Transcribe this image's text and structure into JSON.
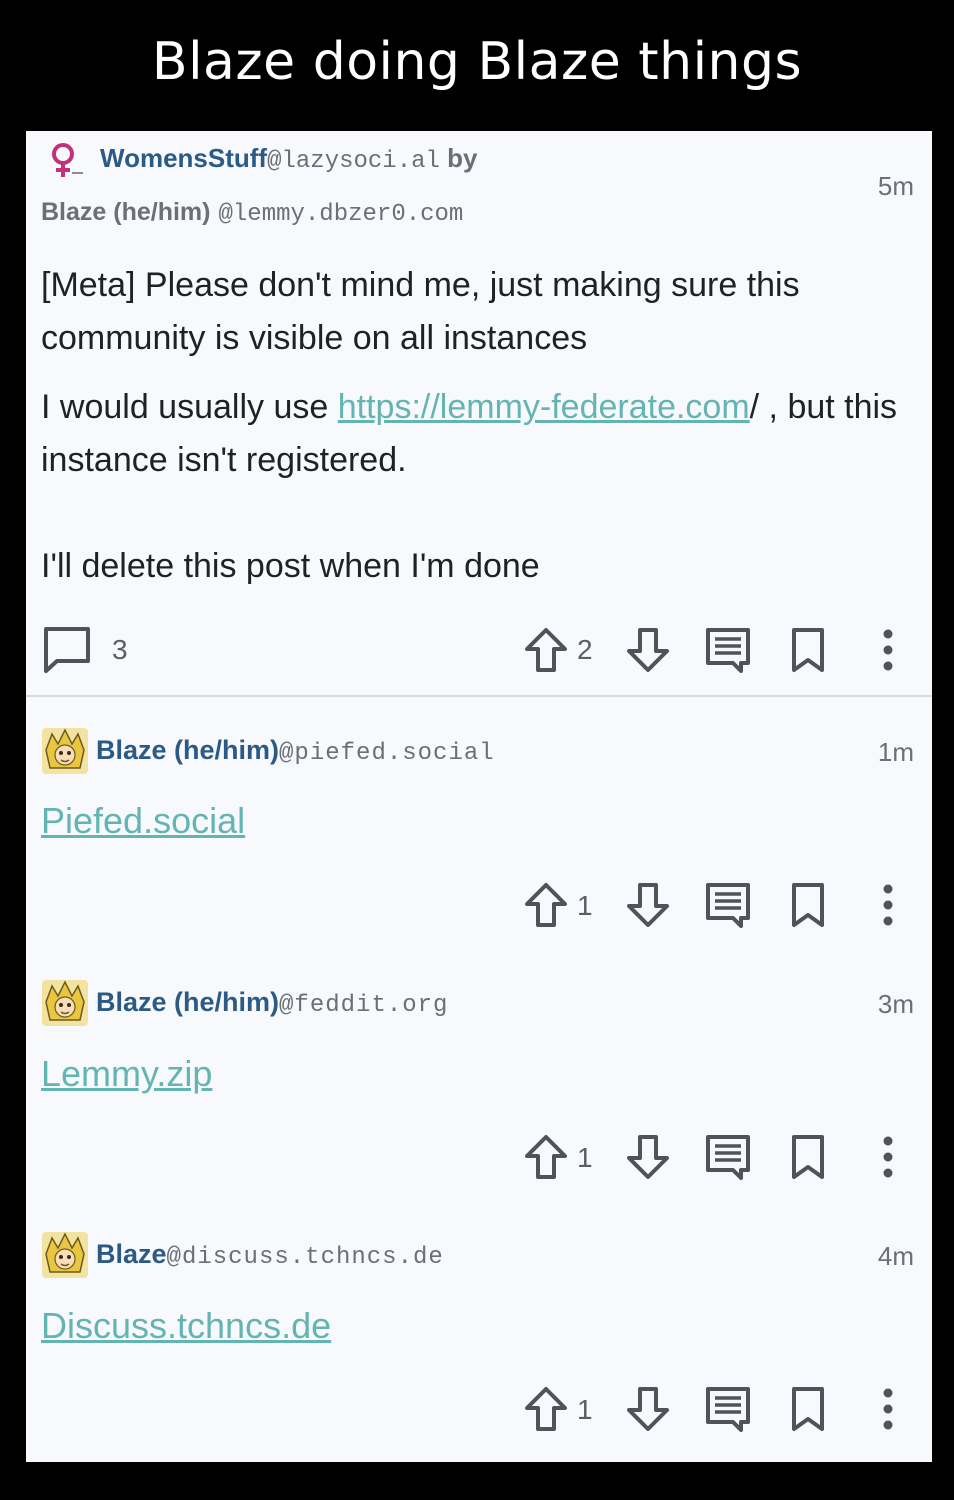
{
  "meme_title": "Blaze doing Blaze things",
  "post": {
    "community_name": "WomensStuff",
    "community_instance": "@lazysoci.al",
    "by_label": "by",
    "author_name": "Blaze (he/him)",
    "author_instance": "@lemmy.dbzer0.com",
    "time": "5m",
    "title": "[Meta] Please don't mind me, just making sure this community is visible on all instances",
    "body_pre": "I would usually use ",
    "body_link": "https://lemmy-federate.com",
    "body_post": "/ , but this instance isn't registered.",
    "body_2": "I'll delete this post when I'm done",
    "comment_count": "3",
    "upvotes": "2",
    "icons": [
      "community-venus-icon",
      "comment-icon",
      "upvote-icon",
      "downvote-icon",
      "reply-icon",
      "bookmark-icon",
      "more-vert-icon"
    ]
  },
  "comments": [
    {
      "author": "Blaze (he/him)",
      "instance": "@piefed.social",
      "time": "1m",
      "text": "Piefed.social",
      "upvotes": "1"
    },
    {
      "author": "Blaze (he/him)",
      "instance": "@feddit.org",
      "time": "3m",
      "text": "Lemmy.zip",
      "upvotes": "1"
    },
    {
      "author": "Blaze",
      "instance": "@discuss.tchncs.de",
      "time": "4m",
      "text": "Discuss.tchncs.de",
      "upvotes": "1"
    }
  ],
  "colors": {
    "background": "#000000",
    "card": "#f8f9fc",
    "link": "#62b5b2",
    "author": "#2b5a84",
    "meta": "#6b6f76"
  }
}
